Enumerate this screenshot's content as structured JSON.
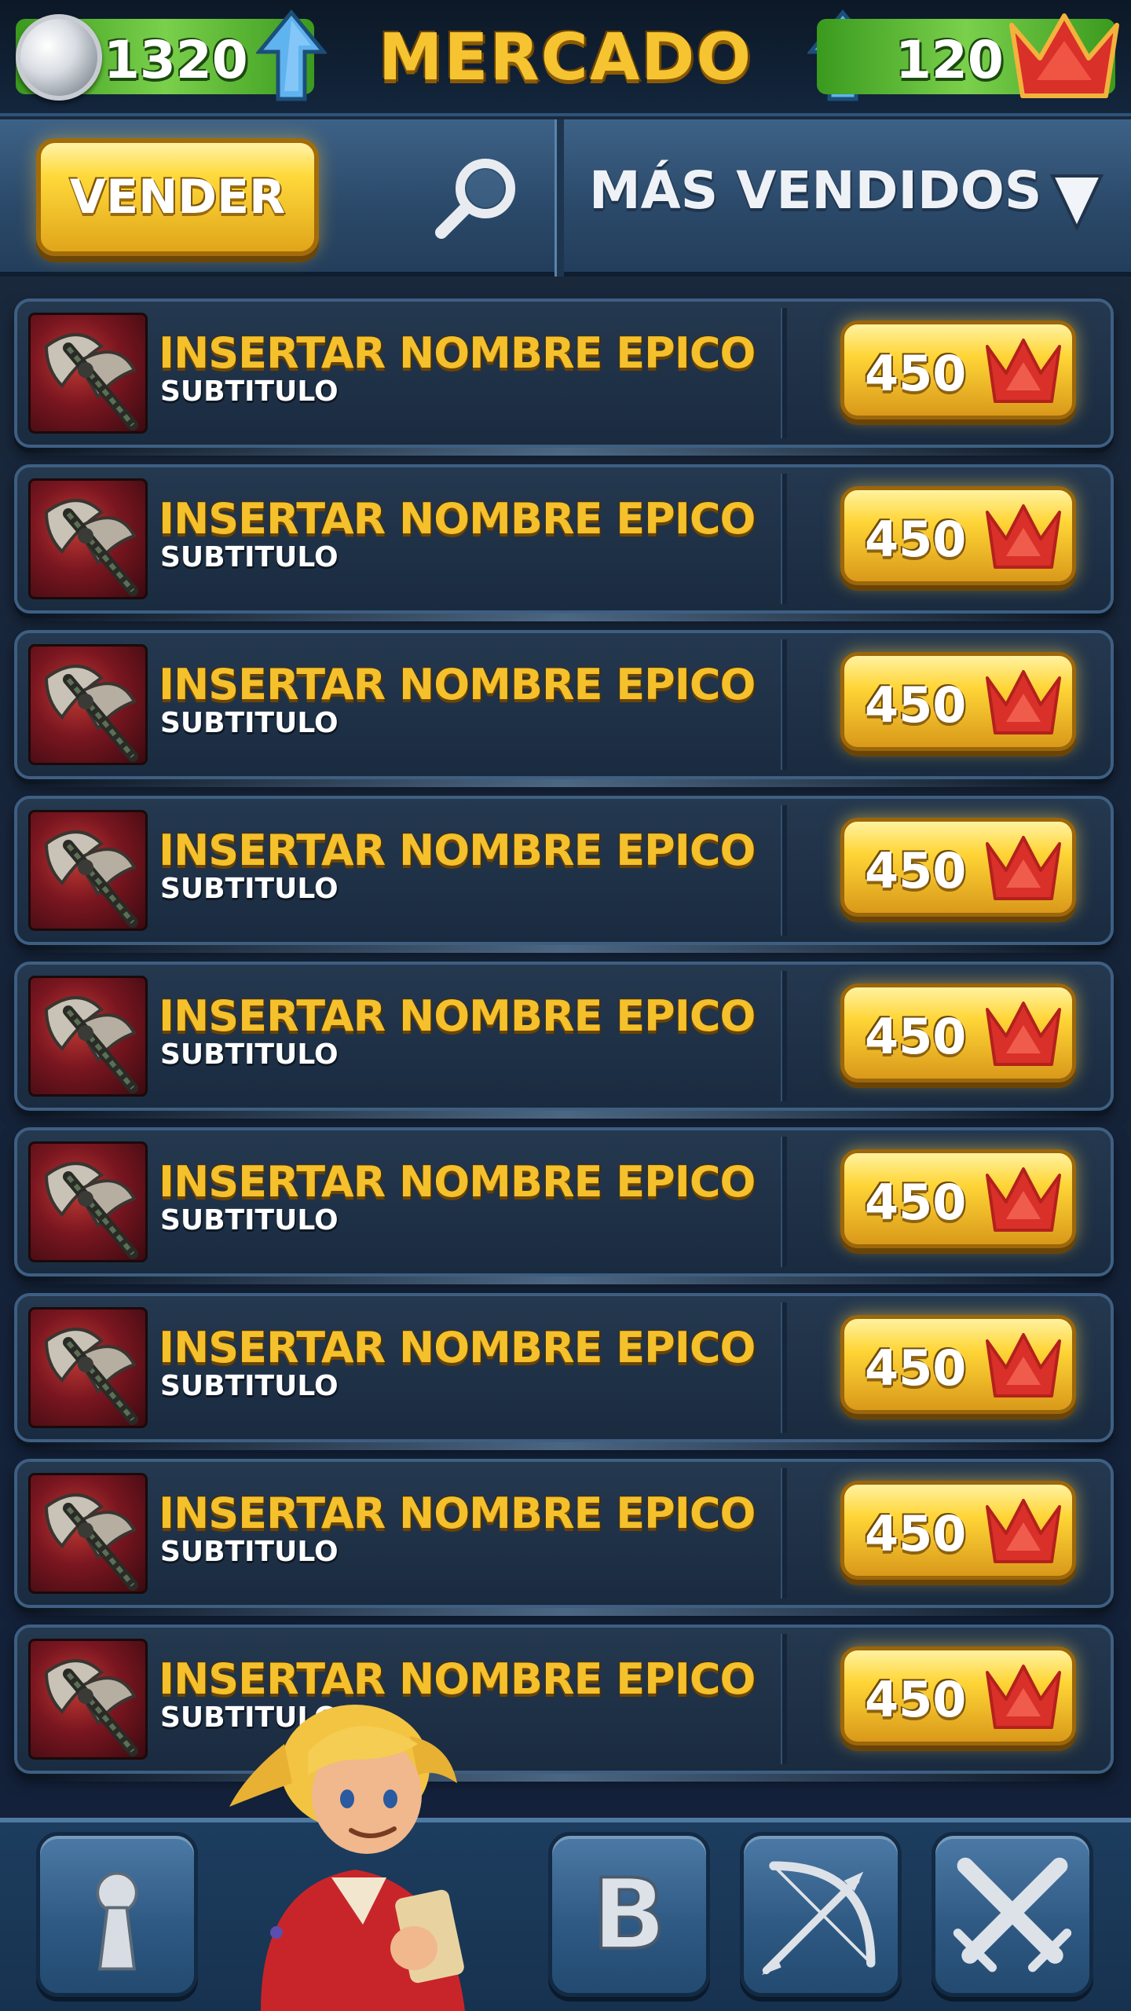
{
  "header": {
    "title": "MERCADO",
    "coins": "1320",
    "crowns": "120"
  },
  "toolbar": {
    "sell_label": "VENDER",
    "sort_label": "MÁS VENDIDOS"
  },
  "items": [
    {
      "name": "INSERTAR NOMBRE EPICO",
      "subtitle": "SUBTITULO",
      "price": "450"
    },
    {
      "name": "INSERTAR NOMBRE EPICO",
      "subtitle": "SUBTITULO",
      "price": "450"
    },
    {
      "name": "INSERTAR NOMBRE EPICO",
      "subtitle": "SUBTITULO",
      "price": "450"
    },
    {
      "name": "INSERTAR NOMBRE EPICO",
      "subtitle": "SUBTITULO",
      "price": "450"
    },
    {
      "name": "INSERTAR NOMBRE EPICO",
      "subtitle": "SUBTITULO",
      "price": "450"
    },
    {
      "name": "INSERTAR NOMBRE EPICO",
      "subtitle": "SUBTITULO",
      "price": "450"
    },
    {
      "name": "INSERTAR NOMBRE EPICO",
      "subtitle": "SUBTITULO",
      "price": "450"
    },
    {
      "name": "INSERTAR NOMBRE EPICO",
      "subtitle": "SUBTITULO",
      "price": "450"
    },
    {
      "name": "INSERTAR NOMBRE EPICO",
      "subtitle": "SUBTITULO",
      "price": "450"
    }
  ],
  "bottom_nav": {
    "b_label": "B",
    "icons": [
      "keyhole-icon",
      "b-letter-icon",
      "bow-arrow-icon",
      "crossed-swords-icon"
    ]
  },
  "colors": {
    "gold": "#f6c431",
    "crown_red": "#d9302a",
    "currency_green": "#5fbf35",
    "panel_blue": "#2a4868"
  }
}
